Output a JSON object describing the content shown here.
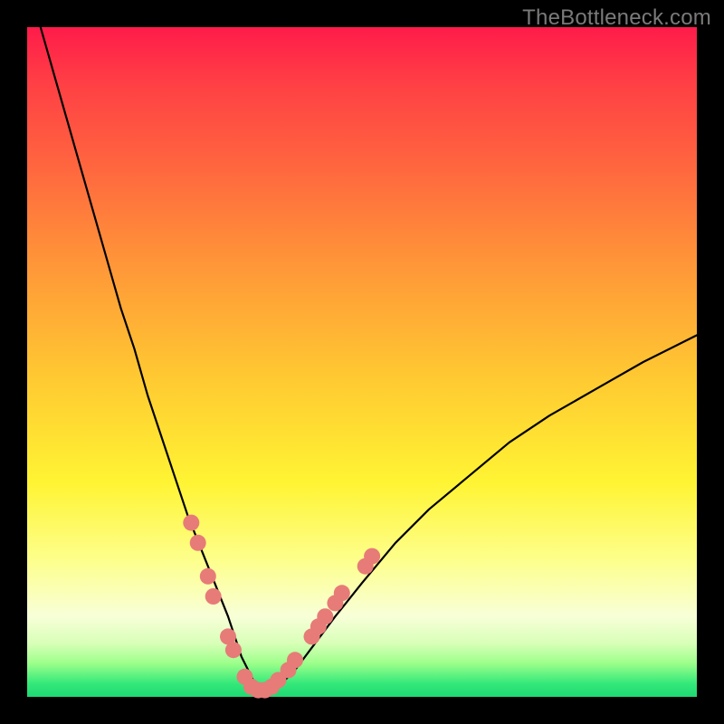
{
  "watermark": "TheBottleneck.com",
  "colors": {
    "frame": "#000000",
    "curve": "#000000",
    "markers": "#e77b78",
    "gradient_top": "#ff1b4a",
    "gradient_bottom": "#1fd873"
  },
  "chart_data": {
    "type": "line",
    "title": "",
    "xlabel": "",
    "ylabel": "",
    "xlim": [
      0,
      100
    ],
    "ylim": [
      0,
      100
    ],
    "grid": false,
    "legend": false,
    "series": [
      {
        "name": "bottleneck-curve",
        "x": [
          2,
          4,
          6,
          8,
          10,
          12,
          14,
          16,
          18,
          20,
          22,
          24,
          26,
          28,
          30,
          31,
          32,
          33,
          34,
          35,
          36,
          38,
          40,
          43,
          46,
          50,
          55,
          60,
          66,
          72,
          78,
          85,
          92,
          100
        ],
        "y": [
          100,
          93,
          86,
          79,
          72,
          65,
          58,
          52,
          45,
          39,
          33,
          27,
          22,
          17,
          12,
          9,
          6,
          4,
          2,
          1,
          1,
          2,
          4,
          8,
          12,
          17,
          23,
          28,
          33,
          38,
          42,
          46,
          50,
          54
        ]
      }
    ],
    "markers": {
      "name": "highlight-points",
      "points": [
        {
          "x": 24.5,
          "y": 26
        },
        {
          "x": 25.5,
          "y": 23
        },
        {
          "x": 27.0,
          "y": 18
        },
        {
          "x": 27.8,
          "y": 15
        },
        {
          "x": 30.0,
          "y": 9
        },
        {
          "x": 30.8,
          "y": 7
        },
        {
          "x": 32.5,
          "y": 3
        },
        {
          "x": 33.5,
          "y": 1.5
        },
        {
          "x": 34.5,
          "y": 1
        },
        {
          "x": 35.5,
          "y": 1
        },
        {
          "x": 36.5,
          "y": 1.5
        },
        {
          "x": 37.5,
          "y": 2.5
        },
        {
          "x": 39.0,
          "y": 4
        },
        {
          "x": 40.0,
          "y": 5.5
        },
        {
          "x": 42.5,
          "y": 9
        },
        {
          "x": 43.5,
          "y": 10.5
        },
        {
          "x": 44.5,
          "y": 12
        },
        {
          "x": 46.0,
          "y": 14
        },
        {
          "x": 47.0,
          "y": 15.5
        },
        {
          "x": 50.5,
          "y": 19.5
        },
        {
          "x": 51.5,
          "y": 21
        }
      ]
    }
  }
}
